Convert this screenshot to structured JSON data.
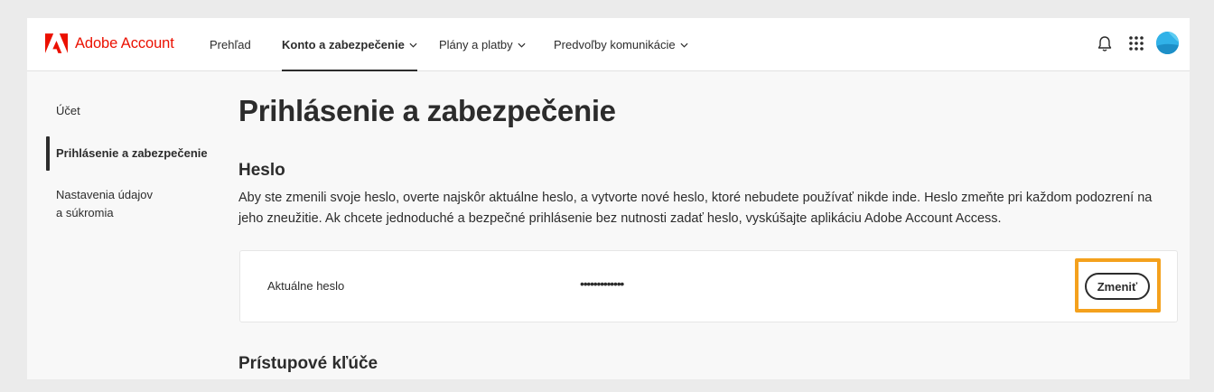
{
  "brand": {
    "name": "Adobe Account",
    "logo_icon": "adobe-logo-icon",
    "color": "#eb1000"
  },
  "topnav": {
    "items": [
      {
        "label": "Prehľad",
        "dropdown": false,
        "active": false
      },
      {
        "label": "Konto a zabezpečenie",
        "dropdown": true,
        "active": true
      },
      {
        "label": "Plány a platby",
        "dropdown": true,
        "active": false
      },
      {
        "label": "Predvoľby komunikácie",
        "dropdown": true,
        "active": false
      }
    ],
    "icons": [
      "bell-icon",
      "apps-grid-icon",
      "avatar"
    ]
  },
  "sidebar": {
    "items": [
      {
        "label": "Účet",
        "active": false
      },
      {
        "label": "Prihlásenie a zabezpečenie",
        "active": true
      },
      {
        "label": "Nastavenia údajov",
        "label2": "a súkromia",
        "active": false
      }
    ]
  },
  "main": {
    "title": "Prihlásenie a zabezpečenie",
    "password_section": {
      "heading": "Heslo",
      "description": "Aby ste zmenili svoje heslo, overte najskôr aktuálne heslo, a vytvorte nové heslo, ktoré nebudete používať nikde inde. Heslo zmeňte pri každom podozrení na jeho zneužitie. Ak chcete jednoduché a bezpečné prihlásenie bez nutnosti zadať heslo, vyskúšajte aplikáciu Adobe Account Access.",
      "current_label": "Aktuálne heslo",
      "current_value": "•••••••••••••",
      "change_button": "Zmeniť",
      "highlight_color": "#f4a11d"
    },
    "passkeys_section": {
      "heading": "Prístupové kľúče"
    }
  }
}
